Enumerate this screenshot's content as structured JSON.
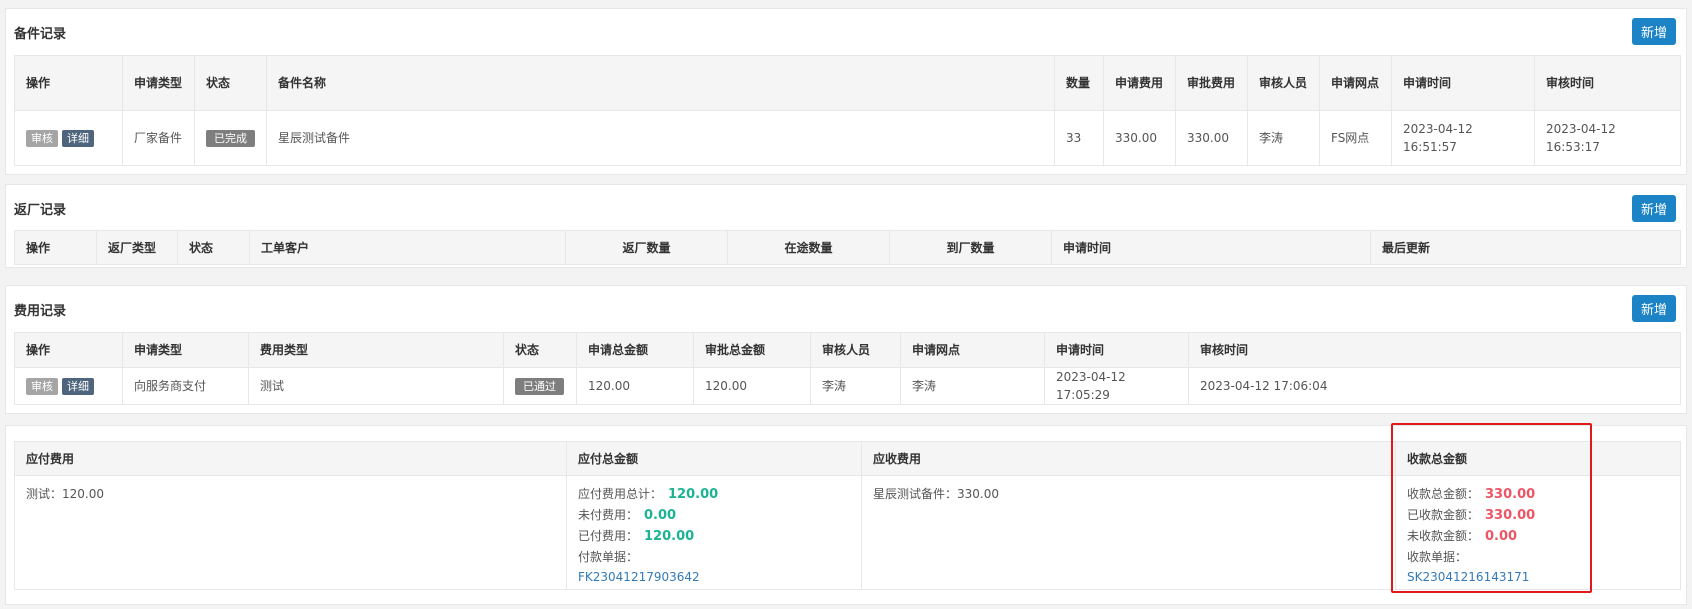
{
  "parts": {
    "title": "备件记录",
    "add_label": "新增",
    "headers": [
      "操作",
      "申请类型",
      "状态",
      "备件名称",
      "数量",
      "申请费用",
      "审批费用",
      "审核人员",
      "申请网点",
      "申请时间",
      "审核时间"
    ],
    "rows": [
      {
        "audit": "审核",
        "detail": "详细",
        "type": "厂家备件",
        "status": "已完成",
        "name": "星辰测试备件",
        "qty": "33",
        "apply_fee": "330.00",
        "approve_fee": "330.00",
        "auditor": "李涛",
        "branch": "FS网点",
        "apply_time": "2023-04-12 16:51:57",
        "audit_time": "2023-04-12 16:53:17"
      }
    ]
  },
  "returns": {
    "title": "返厂记录",
    "add_label": "新增",
    "headers": [
      "操作",
      "返厂类型",
      "状态",
      "工单客户",
      "返厂数量",
      "在途数量",
      "到厂数量",
      "申请时间",
      "最后更新"
    ]
  },
  "fees": {
    "title": "费用记录",
    "add_label": "新增",
    "headers": [
      "操作",
      "申请类型",
      "费用类型",
      "状态",
      "申请总金额",
      "审批总金额",
      "审核人员",
      "申请网点",
      "申请时间",
      "审核时间"
    ],
    "rows": [
      {
        "audit": "审核",
        "detail": "详细",
        "type": "向服务商支付",
        "fee_type": "测试",
        "status": "已通过",
        "apply_total": "120.00",
        "approve_total": "120.00",
        "auditor": "李涛",
        "branch": "李涛",
        "apply_time": "2023-04-12 17:05:29",
        "audit_time": "2023-04-12 17:06:04"
      }
    ]
  },
  "summary": {
    "headers": [
      "应付费用",
      "应付总金额",
      "应收费用",
      "收款总金额"
    ],
    "payable_item": "测试：120.00",
    "payable_total_label": "应付费用总计：",
    "payable_total_value": "120.00",
    "unpaid_label": "未付费用：",
    "unpaid_value": "0.00",
    "paid_label": "已付费用：",
    "paid_value": "120.00",
    "pay_doc_label": "付款单据：",
    "pay_doc_link": "FK23041217903642",
    "receivable_item": "星辰测试备件：330.00",
    "recv_total_label": "收款总金额：",
    "recv_total_value": "330.00",
    "received_label": "已收款金额：",
    "received_value": "330.00",
    "unreceived_label": "未收款金额：",
    "unreceived_value": "0.00",
    "recv_doc_label": "收款单据：",
    "recv_doc_link": "SK23041216143171"
  },
  "colors": {
    "add_button": "#1c84c6",
    "teal_value": "#1ab394",
    "red_value": "#ed5565",
    "link": "#337ab7",
    "highlight": "#e0191d"
  }
}
